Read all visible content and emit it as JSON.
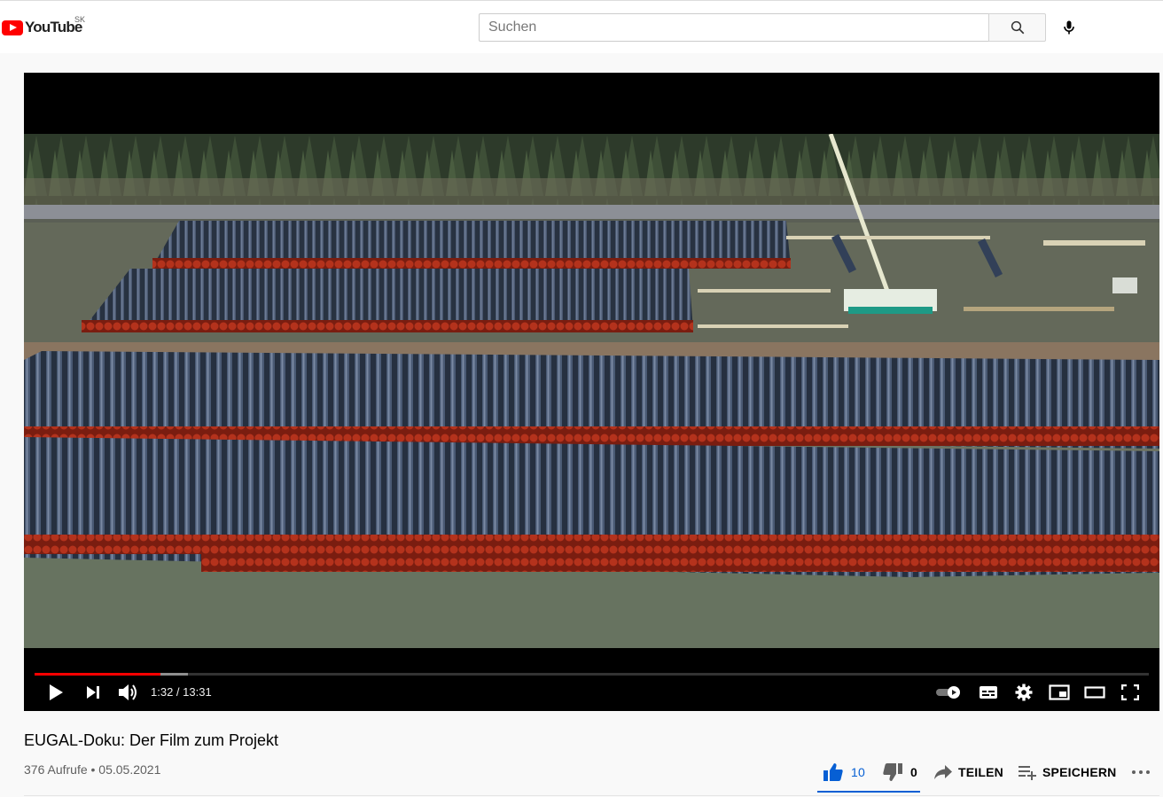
{
  "header": {
    "logo_text": "YouTube",
    "country_code": "SK",
    "search_placeholder": "Suchen"
  },
  "player": {
    "current_time": "1:32",
    "duration": "13:31",
    "time_display": "1:32 / 13:31",
    "progress_played": 0.113,
    "progress_buffered": 0.138,
    "accent_color": "#ff0000"
  },
  "video": {
    "title": "EUGAL-Doku: Der Film zum Projekt",
    "views": "376 Aufrufe",
    "date": "05.05.2021",
    "views_date": "376 Aufrufe • 05.05.2021"
  },
  "actions": {
    "likes": "10",
    "dislikes": "0",
    "share_label": "TEILEN",
    "save_label": "SPEICHERN",
    "like_color": "#065fd4"
  },
  "icons": [
    "youtube-logo-icon",
    "search-icon",
    "mic-icon",
    "play-icon",
    "next-icon",
    "volume-icon",
    "autoplay-toggle-icon",
    "subtitles-icon",
    "settings-icon",
    "miniplayer-icon",
    "theater-icon",
    "fullscreen-icon",
    "thumbs-up-icon",
    "thumbs-down-icon",
    "share-icon",
    "save-playlist-icon",
    "more-icon"
  ]
}
